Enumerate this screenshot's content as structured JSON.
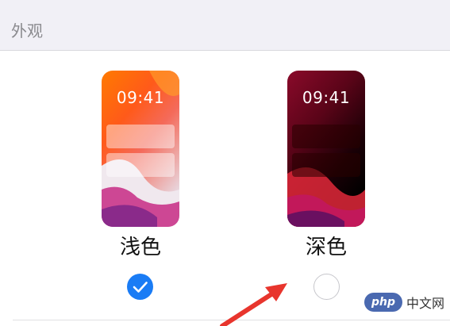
{
  "section": {
    "title": "外观"
  },
  "options": [
    {
      "label": "浅色",
      "time": "09:41",
      "selected": true
    },
    {
      "label": "深色",
      "time": "09:41",
      "selected": false
    }
  ],
  "colors": {
    "accent": "#1a7cf5",
    "annotation_arrow": "#e8352d",
    "header_bg": "#f1f0f6"
  },
  "watermark": {
    "logo": "php",
    "text": "中文网"
  }
}
